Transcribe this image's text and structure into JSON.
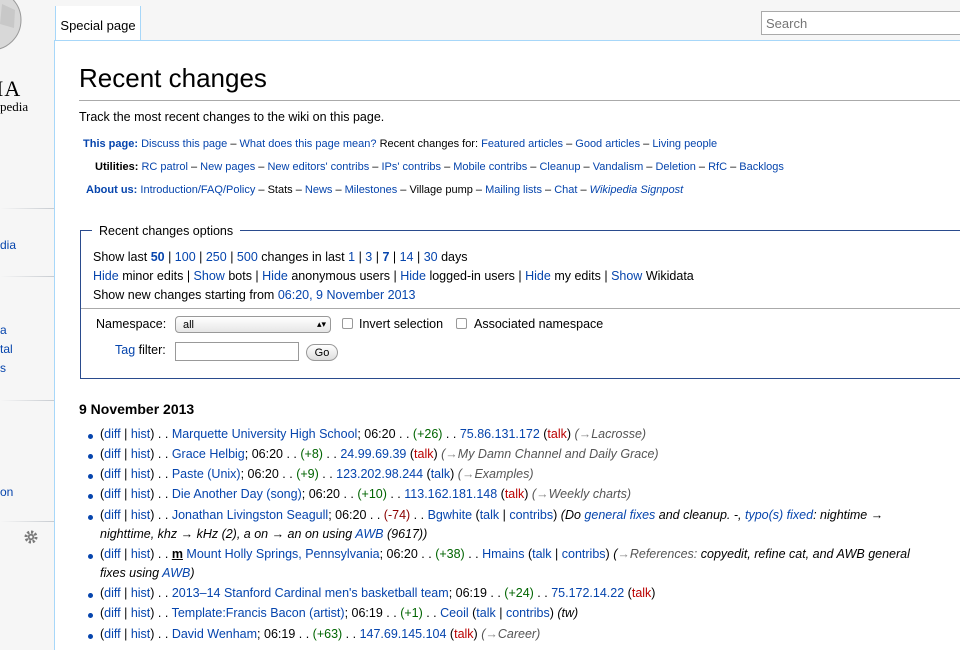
{
  "logo": {
    "text": "IA",
    "sub": "pedia"
  },
  "left_nav": [
    {
      "text": "dia"
    },
    {
      "text": "a"
    },
    {
      "text": "tal"
    },
    {
      "text": "s"
    },
    {
      "text": "on"
    }
  ],
  "tabs": {
    "special": "Special page"
  },
  "search": {
    "placeholder": "Search"
  },
  "page": {
    "title": "Recent changes",
    "intro": "Track the most recent changes to the wiki on this page."
  },
  "nav_rows": {
    "this_page": {
      "label": "This page:",
      "discuss": "Discuss this page",
      "meaning": "What does this page mean?",
      "rc_for": "Recent changes for:",
      "featured": "Featured articles",
      "good": "Good articles",
      "living": "Living people"
    },
    "utilities": {
      "label": "Utilities:",
      "items": [
        "RC patrol",
        "New pages",
        "New editors' contribs",
        "IPs' contribs",
        "Mobile contribs",
        "Cleanup",
        "Vandalism",
        "Deletion",
        "RfC",
        "Backlogs"
      ]
    },
    "about": {
      "label": "About us:",
      "intro": "Introduction/FAQ/Policy",
      "stats": "Stats",
      "news": "News",
      "milestones": "Milestones",
      "pump": "Village pump",
      "mailing": "Mailing lists",
      "chat": "Chat",
      "signpost": "Wikipedia Signpost"
    }
  },
  "options": {
    "legend": "Recent changes options",
    "show_last": "Show last",
    "limits": [
      "50",
      "100",
      "250",
      "500"
    ],
    "changes_in_last": "changes in last",
    "days": [
      "1",
      "3",
      "7",
      "14",
      "30"
    ],
    "days_word": "days",
    "hide": "Hide",
    "show": "Show",
    "minor_edits": "minor edits",
    "bots": "bots",
    "anon": "anonymous users",
    "logged": "logged-in users",
    "my_edits": "my edits",
    "wikidata": "Wikidata",
    "starting_from": "Show new changes starting from",
    "starting_link": "06:20, 9 November 2013",
    "namespace_label": "Namespace:",
    "namespace_value": "all",
    "invert": "Invert selection",
    "associated": "Associated namespace",
    "tag": "Tag",
    "filter": "filter:",
    "go": "Go"
  },
  "date_heading": "9 November 2013",
  "changes": [
    {
      "title": "Marquette University High School",
      "time": "06:20",
      "diff": "(+26)",
      "sign": "pos",
      "user": "75.86.131.172",
      "section": "Lacrosse"
    },
    {
      "title": "Grace Helbig",
      "time": "06:20",
      "diff": "(+8)",
      "sign": "pos",
      "user": "24.99.69.39",
      "section": "My Damn Channel and Daily Grace"
    },
    {
      "title": "Paste (Unix)",
      "time": "06:20",
      "diff": "(+9)",
      "sign": "pos",
      "user": "123.202.98.244",
      "section": "Examples"
    },
    {
      "title": "Die Another Day (song)",
      "time": "06:20",
      "diff": "(+10)",
      "sign": "pos",
      "user": "113.162.181.148",
      "section": "Weekly charts"
    },
    {
      "title": "Jonathan Livingston Seagull",
      "time": "06:20",
      "diff": "(-74)",
      "sign": "neg",
      "user": "Bgwhite",
      "summary_a": "(Do",
      "summary_link1": "general fixes",
      "summary_b": "and cleanup. -,",
      "summary_link2": "typo(s) fixed",
      "summary_c": ": nightime →",
      "summary_line2a": "nighttime, khz → kHz (2), a on → an on using",
      "summary_link3": "AWB",
      "summary_line2b": "(9617))"
    },
    {
      "title": "Mount Holly Springs, Pennsylvania",
      "time": "06:20",
      "diff": "(+38)",
      "sign": "pos",
      "user": "Hmains",
      "minor": "m",
      "section": "References:",
      "summary_a": "copyedit, refine cat, and AWB general",
      "summary_line2a": "fixes using",
      "summary_link3": "AWB"
    },
    {
      "title": "2013–14 Stanford Cardinal men's basketball team",
      "time": "06:19",
      "diff": "(+24)",
      "sign": "pos",
      "user": "75.172.14.22"
    },
    {
      "title": "Template:Francis Bacon (artist)",
      "time": "06:19",
      "diff": "(+1)",
      "sign": "pos",
      "user": "Ceoil",
      "summary_a": "(tw)"
    },
    {
      "title": "David Wenham",
      "time": "06:19",
      "diff": "(+63)",
      "sign": "pos",
      "user": "147.69.145.104",
      "section": "Career"
    }
  ],
  "labels": {
    "diff": "diff",
    "hist": "hist",
    "talk": "talk",
    "contribs": "contribs",
    "arrow": "→"
  },
  "colors": {
    "link": "#0645ad",
    "talk": "#ba0000",
    "positive": "#006400",
    "negative": "#8b0000",
    "border": "#a7d7f9"
  }
}
